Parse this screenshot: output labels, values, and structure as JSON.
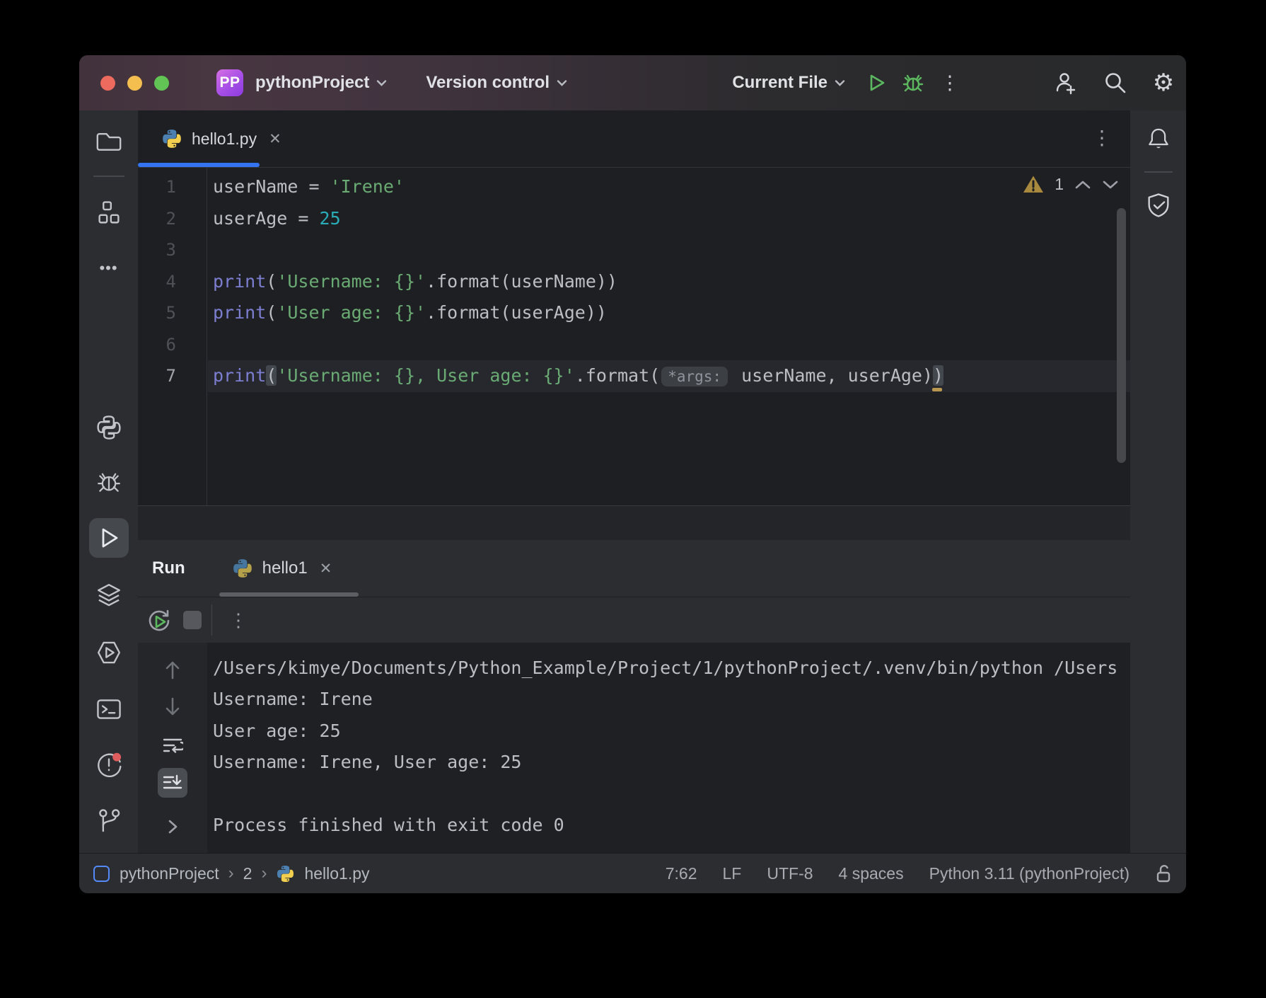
{
  "titlebar": {
    "project": "pythonProject",
    "version_control": "Version control",
    "run_config": "Current File"
  },
  "icons": {
    "close_tab": "✕",
    "more_vertical": "⋮",
    "more_horizontal": "•••",
    "gear": "⚙",
    "crumb_sep": "›"
  },
  "editor_tab": {
    "name": "hello1.py"
  },
  "editor": {
    "warning_count": "1",
    "lines": [
      {
        "num": "1",
        "current": false,
        "tokens": [
          {
            "t": "userName = ",
            "c": "d"
          },
          {
            "t": "'Irene'",
            "c": "s"
          }
        ]
      },
      {
        "num": "2",
        "current": false,
        "tokens": [
          {
            "t": "userAge = ",
            "c": "d"
          },
          {
            "t": "25",
            "c": "n"
          }
        ]
      },
      {
        "num": "3",
        "current": false,
        "tokens": []
      },
      {
        "num": "4",
        "current": false,
        "tokens": [
          {
            "t": "print",
            "c": "k"
          },
          {
            "t": "(",
            "c": "d"
          },
          {
            "t": "'Username: {}'",
            "c": "s"
          },
          {
            "t": ".format(userName))",
            "c": "d"
          }
        ]
      },
      {
        "num": "5",
        "current": false,
        "tokens": [
          {
            "t": "print",
            "c": "k"
          },
          {
            "t": "(",
            "c": "d"
          },
          {
            "t": "'User age: {}'",
            "c": "s"
          },
          {
            "t": ".format(userAge))",
            "c": "d"
          }
        ]
      },
      {
        "num": "6",
        "current": false,
        "tokens": []
      },
      {
        "num": "7",
        "current": true,
        "tokens": [
          {
            "t": "print",
            "c": "k"
          },
          {
            "t": "(",
            "c": "pm"
          },
          {
            "t": "'Username: {}, User age: {}'",
            "c": "s"
          },
          {
            "t": ".format(",
            "c": "d"
          },
          {
            "t": "*args:",
            "c": "hint"
          },
          {
            "t": " userName, userAge)",
            "c": "d"
          },
          {
            "t": ")",
            "c": "pm"
          },
          {
            "t": "",
            "c": "ym"
          }
        ]
      }
    ]
  },
  "run_panel": {
    "title": "Run",
    "tab": "hello1"
  },
  "console": {
    "lines": [
      "/Users/kimye/Documents/Python_Example/Project/1/pythonProject/.venv/bin/python /Users",
      "Username: Irene",
      "User age: 25",
      "Username: Irene, User age: 25",
      "",
      "Process finished with exit code 0"
    ]
  },
  "statusbar": {
    "project": "pythonProject",
    "folder": "2",
    "file": "hello1.py",
    "caret": "7:62",
    "line_ending": "LF",
    "encoding": "UTF-8",
    "indent": "4 spaces",
    "interpreter": "Python 3.11 (pythonProject)"
  },
  "colors": {
    "accent_blue": "#3574f0",
    "traffic_close": "#ec6a5e",
    "traffic_min": "#f5bf4f",
    "traffic_max": "#61c455",
    "string_green": "#6aab73",
    "number_cyan": "#2aacb8",
    "keyword_purple": "#7c7fd1",
    "warning_yellow": "#a8893e",
    "run_green": "#5cb85f"
  }
}
